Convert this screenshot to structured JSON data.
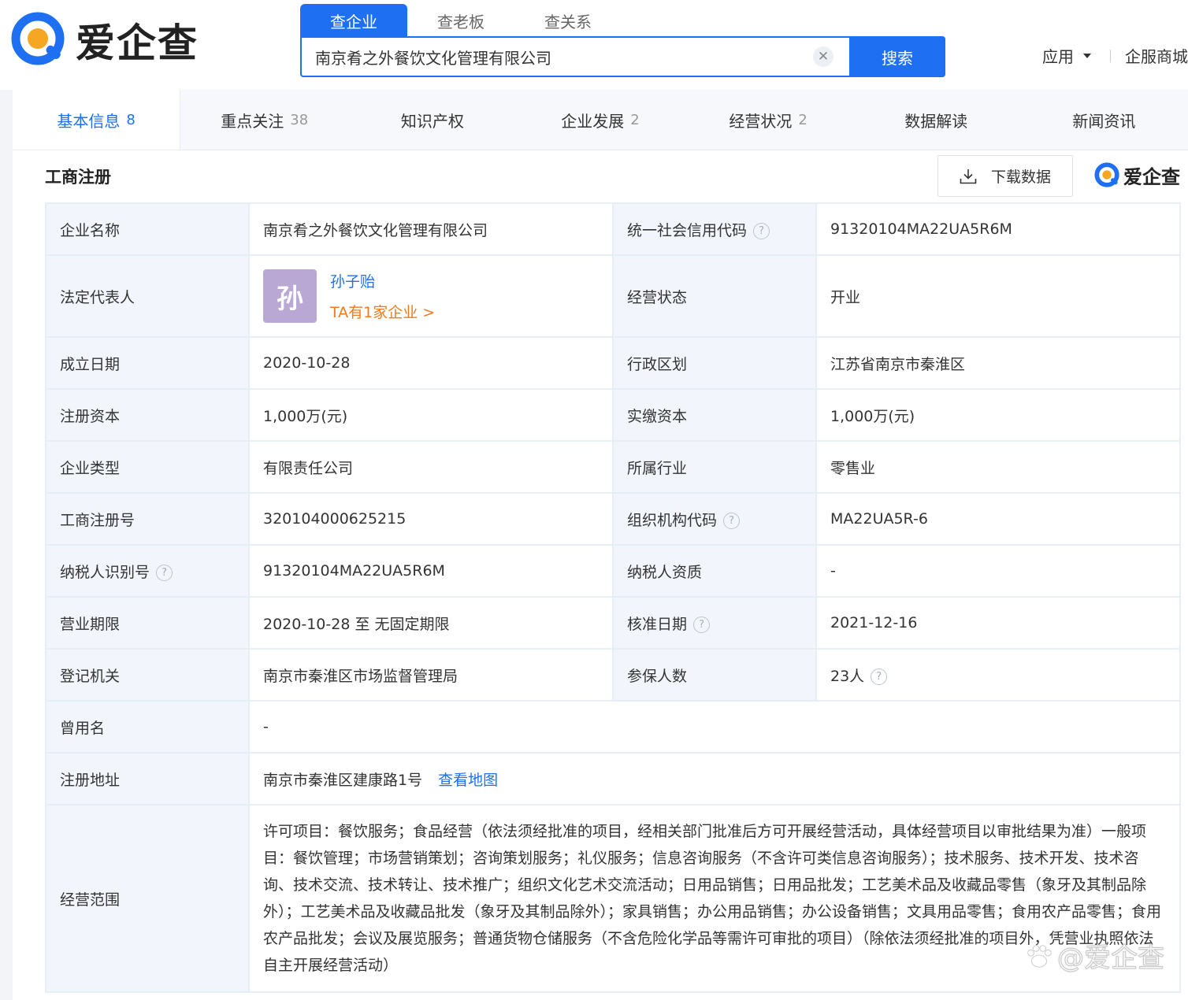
{
  "brand": {
    "name": "爱企查",
    "color": "#1e6ff1",
    "accent": "#f5a623"
  },
  "search": {
    "tabs": [
      "查企业",
      "查老板",
      "查关系"
    ],
    "value": "南京肴之外餐饮文化管理有限公司",
    "button": "搜索",
    "clear_icon": "close-icon"
  },
  "header_links": {
    "apps": "应用",
    "enterprise_services": "企服商城"
  },
  "nav": [
    {
      "label": "基本信息",
      "count": "8"
    },
    {
      "label": "重点关注",
      "count": "38"
    },
    {
      "label": "知识产权",
      "count": ""
    },
    {
      "label": "企业发展",
      "count": "2"
    },
    {
      "label": "经营状况",
      "count": "2"
    },
    {
      "label": "数据解读",
      "count": ""
    },
    {
      "label": "新闻资讯",
      "count": ""
    }
  ],
  "section": {
    "title": "工商注册",
    "download": "下载数据"
  },
  "info": {
    "company_name": {
      "label": "企业名称",
      "value": "南京肴之外餐饮文化管理有限公司"
    },
    "credit_code": {
      "label": "统一社会信用代码",
      "value": "91320104MA22UA5R6M"
    },
    "legal_rep": {
      "label": "法定代表人",
      "avatar": "孙",
      "name": "孙子贻",
      "link": "TA有1家企业 >"
    },
    "status": {
      "label": "经营状态",
      "value": "开业"
    },
    "founded": {
      "label": "成立日期",
      "value": "2020-10-28"
    },
    "region": {
      "label": "行政区划",
      "value": "江苏省南京市秦淮区"
    },
    "reg_capital": {
      "label": "注册资本",
      "value": "1,000万(元)"
    },
    "paid_capital": {
      "label": "实缴资本",
      "value": "1,000万(元)"
    },
    "type": {
      "label": "企业类型",
      "value": "有限责任公司"
    },
    "industry": {
      "label": "所属行业",
      "value": "零售业"
    },
    "reg_no": {
      "label": "工商注册号",
      "value": "320104000625215"
    },
    "org_code": {
      "label": "组织机构代码",
      "value": "MA22UA5R-6"
    },
    "tax_id": {
      "label": "纳税人识别号",
      "value": "91320104MA22UA5R6M"
    },
    "tax_qual": {
      "label": "纳税人资质",
      "value": "-"
    },
    "term": {
      "label": "营业期限",
      "value": "2020-10-28 至 无固定期限"
    },
    "approval_date": {
      "label": "核准日期",
      "value": "2021-12-16"
    },
    "authority": {
      "label": "登记机关",
      "value": "南京市秦淮区市场监督管理局"
    },
    "insured": {
      "label": "参保人数",
      "value": "23人"
    },
    "former_name": {
      "label": "曾用名",
      "value": "-"
    },
    "address": {
      "label": "注册地址",
      "value": "南京市秦淮区建康路1号",
      "map_link": "查看地图"
    },
    "scope": {
      "label": "经营范围",
      "value": "许可项目：餐饮服务；食品经营（依法须经批准的项目，经相关部门批准后方可开展经营活动，具体经营项目以审批结果为准）一般项目：餐饮管理；市场营销策划；咨询策划服务；礼仪服务；信息咨询服务（不含许可类信息咨询服务）；技术服务、技术开发、技术咨询、技术交流、技术转让、技术推广；组织文化艺术交流活动；日用品销售；日用品批发；工艺美术品及收藏品零售（象牙及其制品除外）；工艺美术品及收藏品批发（象牙及其制品除外）；家具销售；办公用品销售；办公设备销售；文具用品零售；食用农产品零售；食用农产品批发；会议及展览服务；普通货物仓储服务（不含危险化学品等需许可审批的项目）（除依法须经批准的项目外，凭营业执照依法自主开展经营活动）"
    }
  },
  "watermark": "@爱企查"
}
